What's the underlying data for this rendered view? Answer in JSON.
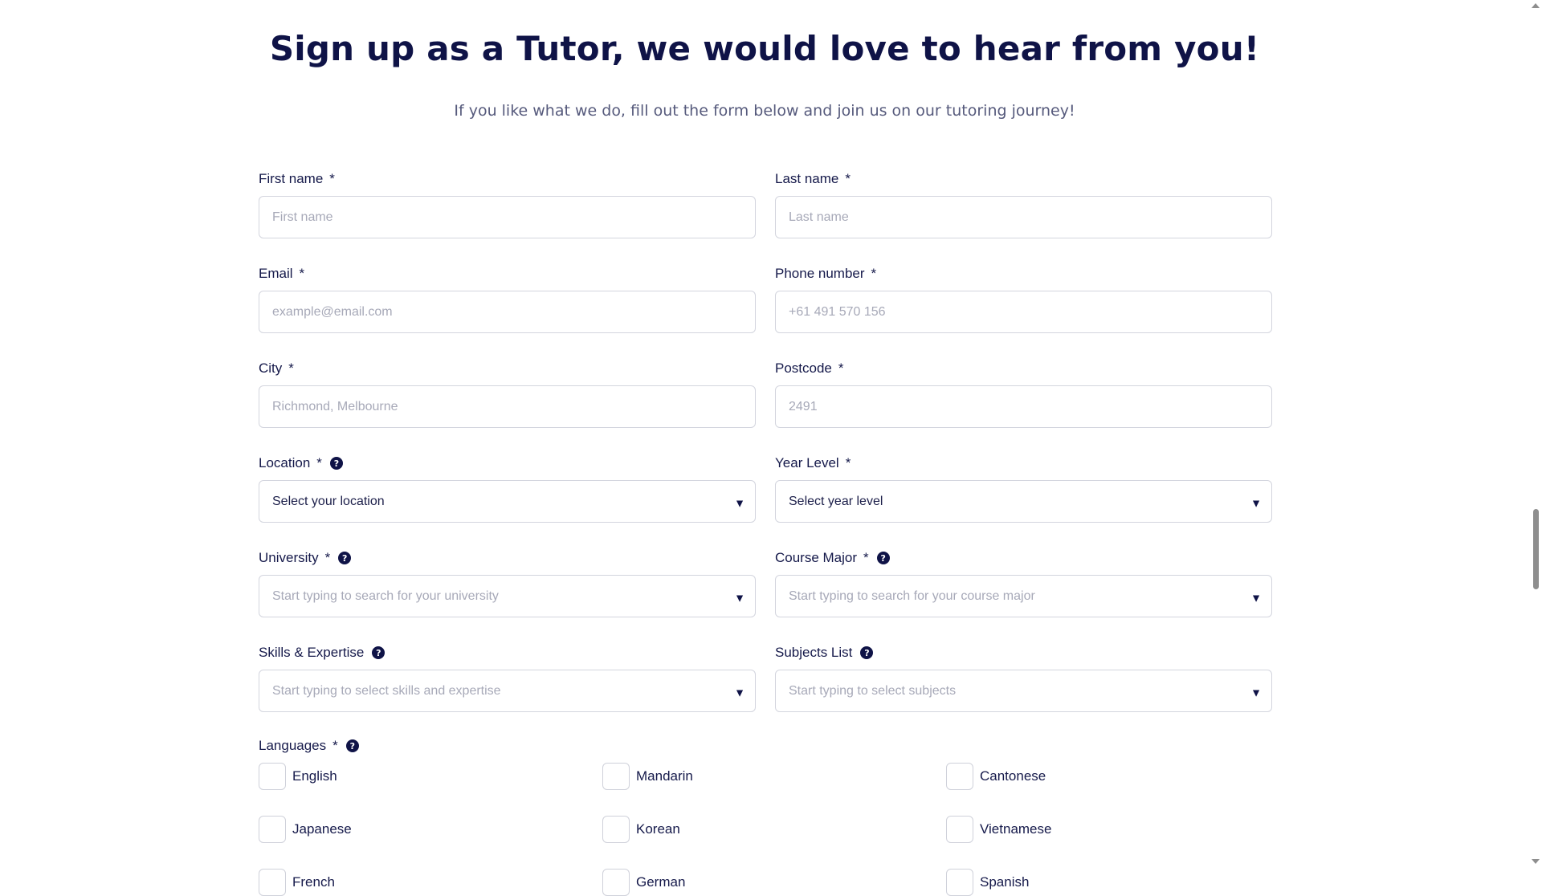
{
  "header": {
    "title": "Sign up as a Tutor, we would love to hear from you!",
    "subtitle": "If you like what we do, fill out the form below and join us on our tutoring journey!"
  },
  "form": {
    "required_marker": "*",
    "help_glyph": "?",
    "first_name": {
      "label": "First name",
      "placeholder": "First name",
      "value": ""
    },
    "last_name": {
      "label": "Last name",
      "placeholder": "Last name",
      "value": ""
    },
    "email": {
      "label": "Email",
      "placeholder": "example@email.com",
      "value": ""
    },
    "phone": {
      "label": "Phone number",
      "placeholder": "+61 491 570 156",
      "value": ""
    },
    "city": {
      "label": "City",
      "placeholder": "Richmond, Melbourne",
      "value": ""
    },
    "postcode": {
      "label": "Postcode",
      "placeholder": "2491",
      "value": ""
    },
    "location": {
      "label": "Location",
      "selected": "Select your location"
    },
    "year_level": {
      "label": "Year Level",
      "selected": "Select year level"
    },
    "university": {
      "label": "University",
      "placeholder": "Start typing to search for your university"
    },
    "course_major": {
      "label": "Course Major",
      "placeholder": "Start typing to search for your course major"
    },
    "skills": {
      "label": "Skills & Expertise",
      "placeholder": "Start typing to select skills and expertise"
    },
    "subjects": {
      "label": "Subjects List",
      "placeholder": "Start typing to select subjects"
    },
    "languages": {
      "label": "Languages",
      "options": [
        "English",
        "Mandarin",
        "Cantonese",
        "Japanese",
        "Korean",
        "Vietnamese",
        "French",
        "German",
        "Spanish"
      ]
    }
  },
  "icons": {
    "dropdown": "caret-down-icon",
    "help": "question-circle-icon"
  },
  "colors": {
    "heading": "#0f1347",
    "subtitle": "#565a7c",
    "border": "#d3d5de",
    "placeholder": "#a7a9b8"
  }
}
